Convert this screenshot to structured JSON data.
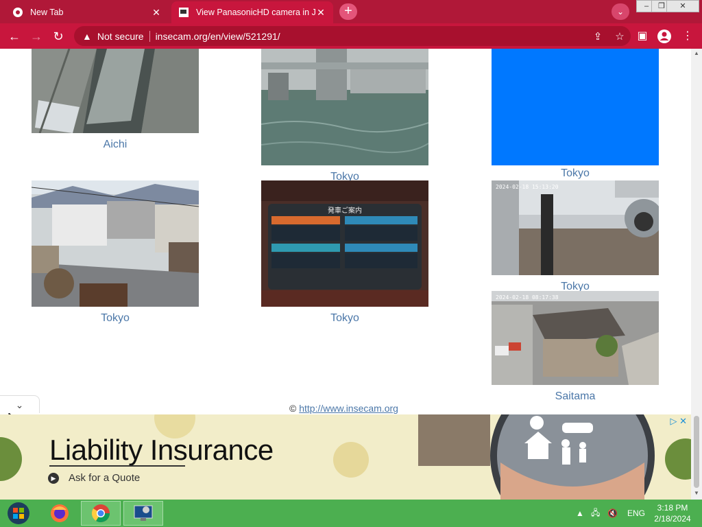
{
  "browser": {
    "tabs": [
      {
        "title": "New Tab",
        "active": false
      },
      {
        "title": "View PanasonicHD camera in Jap",
        "active": true
      }
    ],
    "address": {
      "security_label": "Not secure",
      "url": "insecam.org/en/view/521291/"
    }
  },
  "cameras": [
    {
      "location": "Aichi"
    },
    {
      "location": "Tokyo"
    },
    {
      "location": "Tokyo"
    },
    {
      "location": "Tokyo"
    },
    {
      "location": "Tokyo"
    },
    {
      "location": "Tokyo"
    },
    {
      "location": "Saitama"
    }
  ],
  "overlays": {
    "board_title": "発車ご案内",
    "cam6_timestamp": "2024-02-18  15:13:20",
    "cam7_timestamp": "2024-02-18  08:17:38"
  },
  "footer": {
    "copyright": "©",
    "link": "http://www.insecam.org"
  },
  "ad": {
    "headline": "Liability Insurance",
    "cta": "Ask for a Quote"
  },
  "taskbar": {
    "language": "ENG",
    "time": "3:18 PM",
    "date": "2/18/2024"
  },
  "colors": {
    "tab_bar": "#b01838",
    "toolbar": "#c8163d",
    "link": "#4b77a8",
    "ad_bg": "#f2edc9",
    "taskbar": "#4caf50"
  }
}
